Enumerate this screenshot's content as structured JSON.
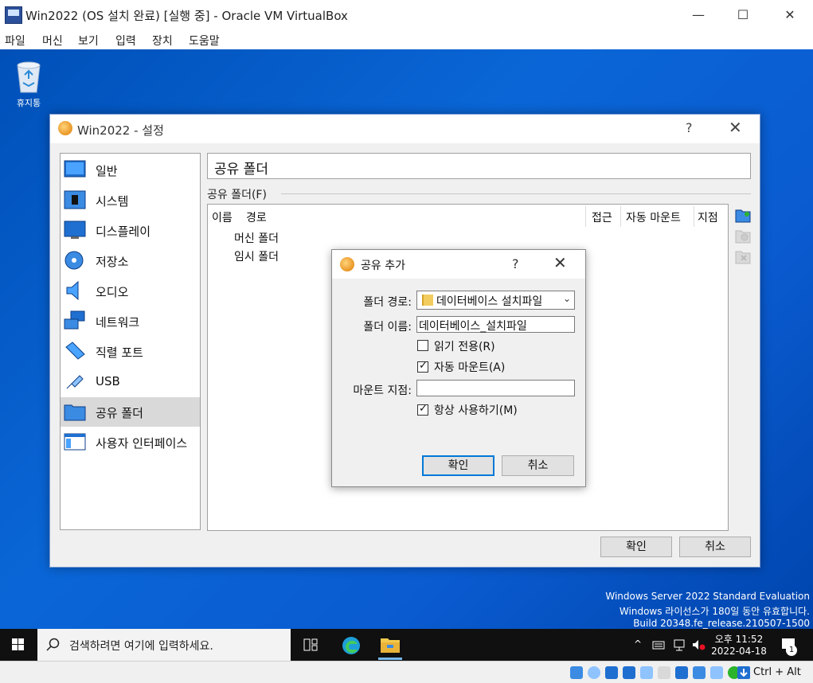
{
  "vbox": {
    "title": "Win2022 (OS 설치 완료) [실행 중] - Oracle VM VirtualBox",
    "menu": [
      "파일",
      "머신",
      "보기",
      "입력",
      "장치",
      "도움말"
    ],
    "controls": {
      "minimize": "—",
      "maximize": "☐",
      "close": "✕"
    }
  },
  "desktop": {
    "recycle_bin_label": "휴지통",
    "watermark": [
      "Windows Server 2022 Standard Evaluation",
      "Windows 라이선스가 180일 동안 유효합니다.",
      "Build 20348.fe_release.210507-1500"
    ]
  },
  "settings": {
    "title": "Win2022 - 설정",
    "help": "?",
    "close": "✕",
    "nav": [
      {
        "label": "일반",
        "icon": "general-icon"
      },
      {
        "label": "시스템",
        "icon": "system-icon"
      },
      {
        "label": "디스플레이",
        "icon": "display-icon"
      },
      {
        "label": "저장소",
        "icon": "storage-icon"
      },
      {
        "label": "오디오",
        "icon": "audio-icon"
      },
      {
        "label": "네트워크",
        "icon": "network-icon"
      },
      {
        "label": "직렬 포트",
        "icon": "serial-port-icon"
      },
      {
        "label": "USB",
        "icon": "usb-icon"
      },
      {
        "label": "공유 폴더",
        "icon": "shared-folder-icon",
        "active": true
      },
      {
        "label": "사용자 인터페이스",
        "icon": "user-interface-icon"
      }
    ],
    "page_title": "공유 폴더",
    "group_label": "공유 폴더(F)",
    "columns": [
      "이름",
      "경로",
      "접근",
      "자동 마운트",
      "지점"
    ],
    "tree": [
      "머신 폴더",
      "임시 폴더"
    ],
    "ok": "확인",
    "cancel": "취소"
  },
  "add_share": {
    "title": "공유 추가",
    "help": "?",
    "close": "✕",
    "path_label": "폴더 경로:",
    "path_value": "데이터베이스 설치파일",
    "name_label": "폴더 이름:",
    "name_value": "데이터베이스_설치파일",
    "readonly_label": "읽기 전용(R)",
    "readonly_checked": false,
    "automount_label": "자동 마운트(A)",
    "automount_checked": true,
    "mountpoint_label": "마운트 지점:",
    "mountpoint_value": "",
    "permanent_label": "항상 사용하기(M)",
    "permanent_checked": true,
    "ok": "확인",
    "cancel": "취소"
  },
  "taskbar": {
    "search_placeholder": "검색하려면 여기에 입력하세요.",
    "time": "오후 11:52",
    "date": "2022-04-18",
    "notification_count": "1"
  },
  "statusbar": {
    "host_key": "Ctrl + Alt"
  }
}
